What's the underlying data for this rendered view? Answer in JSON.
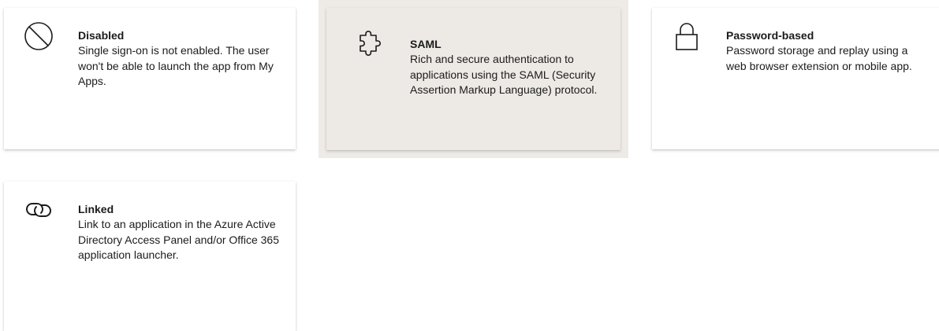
{
  "options": [
    {
      "id": "disabled",
      "icon": "disabled-circle-icon",
      "title": "Disabled",
      "description": "Single sign-on is not enabled. The user won't be able to launch the app from My Apps."
    },
    {
      "id": "saml",
      "icon": "puzzle-piece-icon",
      "title": "SAML",
      "description": "Rich and secure authentication to applications using the SAML (Security Assertion Markup Language) protocol.",
      "selected": true
    },
    {
      "id": "password",
      "icon": "lock-icon",
      "title": "Password-based",
      "description": "Password storage and replay using a web browser extension or mobile app."
    },
    {
      "id": "linked",
      "icon": "link-icon",
      "title": "Linked",
      "description": "Link to an application in the Azure Active Directory Access Panel and/or Office 365 application launcher."
    }
  ],
  "colors": {
    "selected_background": "#edeae6",
    "tile_background": "#ffffff",
    "text": "#1b1b1b"
  }
}
